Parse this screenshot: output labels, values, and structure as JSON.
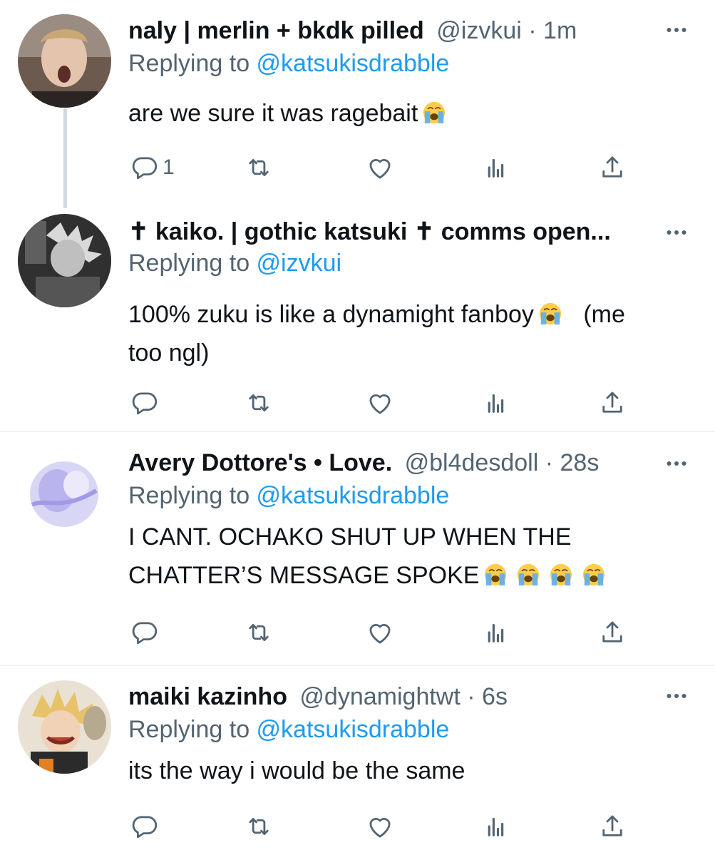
{
  "tweets": [
    {
      "display_name": "naly | merlin + bkdk pilled",
      "handle": "@izvkui",
      "dot": "·",
      "time": "1m",
      "replying_prefix": "Replying to ",
      "replying_handle": "@katsukisdrabble",
      "text_lines": [
        "are we sure it was ragebait"
      ],
      "reply_count": "1"
    },
    {
      "display_name": "✝ kaiko. | gothic katsuki ✝ comms open...",
      "replying_prefix": "Replying to ",
      "replying_handle": "@izvkui",
      "text_lines": [
        "100% zuku is like a dynamight fanboy",
        "(me",
        "too ngl)"
      ]
    },
    {
      "display_name": "Avery Dottore's • Love.",
      "handle": "@bl4desdoll",
      "dot": "·",
      "time": "28s",
      "replying_prefix": "Replying to ",
      "replying_handle": "@katsukisdrabble",
      "text_lines": [
        "I CANT. OCHAKO SHUT UP WHEN THE",
        "CHATTER’S MESSAGE SPOKE"
      ]
    },
    {
      "display_name": "maiki kazinho",
      "handle": "@dynamightwt",
      "dot": "·",
      "time": "6s",
      "replying_prefix": "Replying to ",
      "replying_handle": "@katsukisdrabble",
      "text_lines": [
        "its the way i would be the same"
      ]
    }
  ],
  "icons": {
    "reply": "reply-icon",
    "retweet": "retweet-icon",
    "like": "like-icon",
    "views": "views-icon",
    "share": "share-icon",
    "more": "more-icon",
    "emoji": "loudly-crying-face-emoji"
  },
  "colors": {
    "link": "#1d9bf0",
    "secondary_text": "#536471",
    "primary_text": "#0f1419",
    "divider": "#eff3f4",
    "thread_line": "#cfd9de"
  }
}
